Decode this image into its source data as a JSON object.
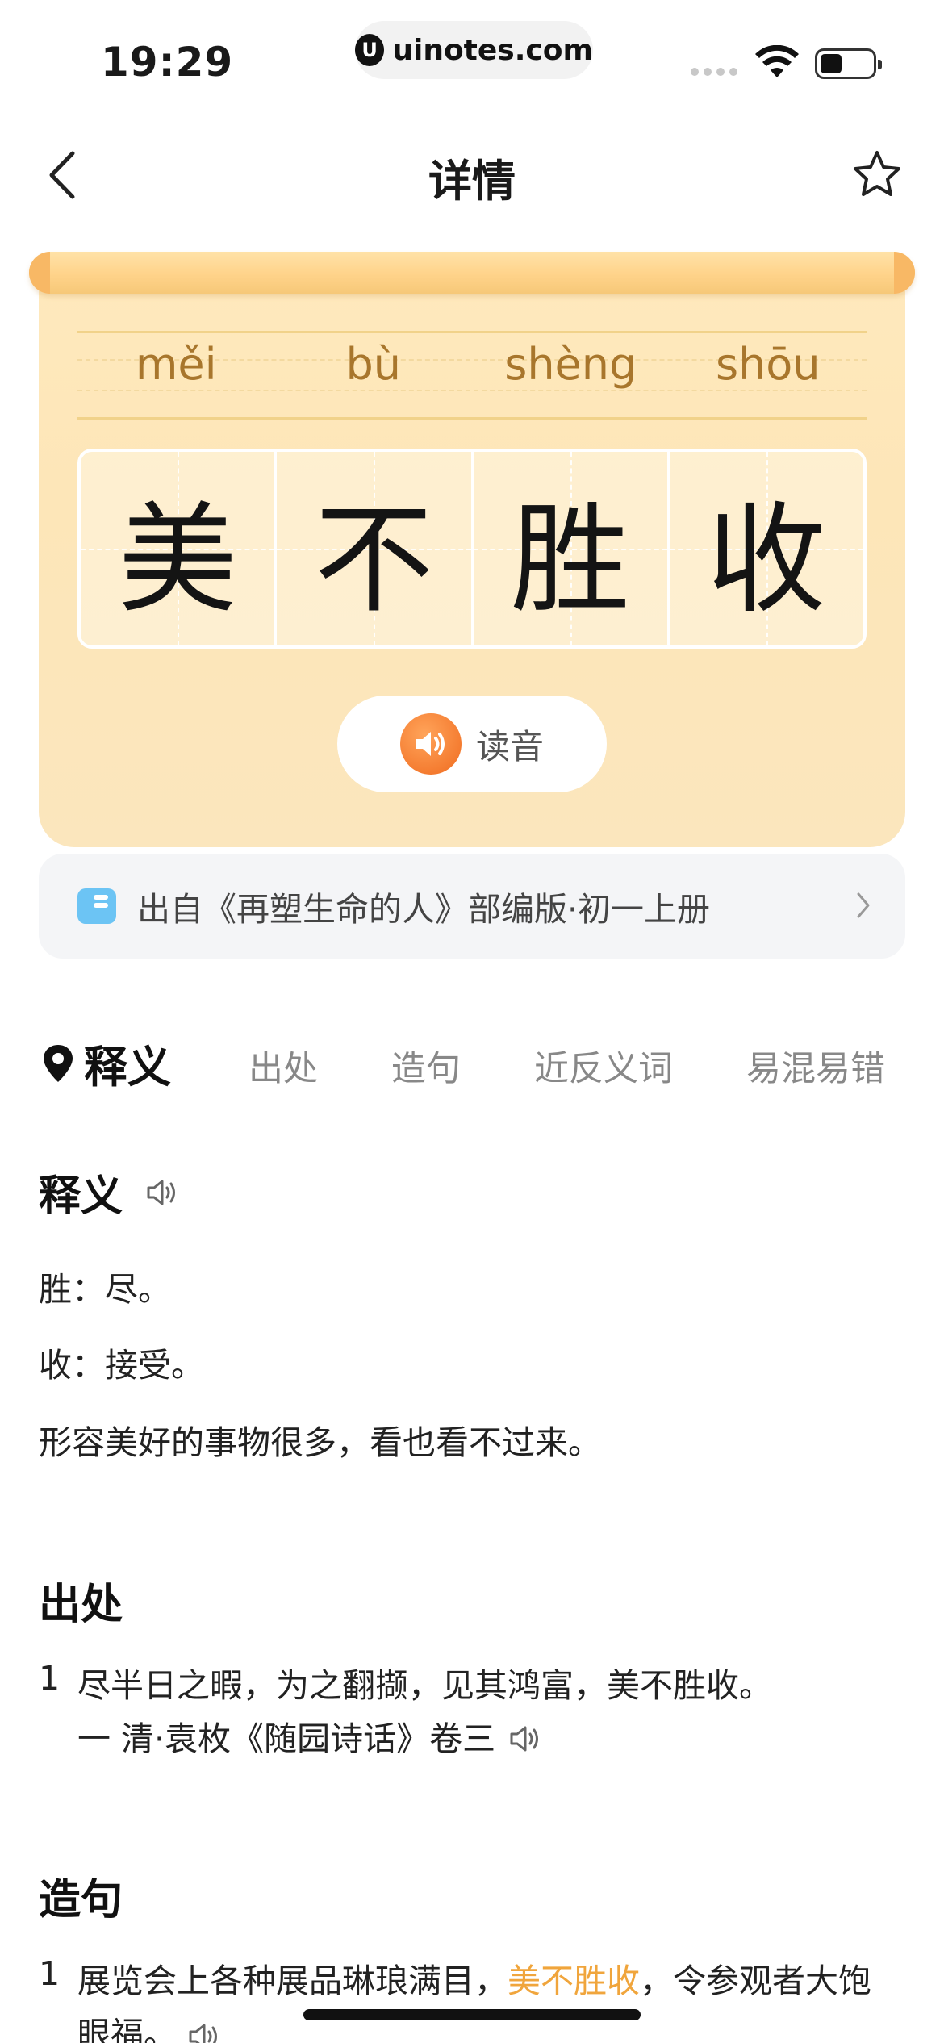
{
  "status_bar": {
    "time": "19:29",
    "url": "uinotes.com"
  },
  "nav": {
    "title": "详情"
  },
  "idiom": {
    "pinyin": [
      "měi",
      "bù",
      "shèng",
      "shōu"
    ],
    "chars": [
      "美",
      "不",
      "胜",
      "收"
    ],
    "read_label": "读音"
  },
  "source": {
    "text": "出自《再塑生命的人》部编版·初一上册"
  },
  "tabs": [
    {
      "label": "释义"
    },
    {
      "label": "出处"
    },
    {
      "label": "造句"
    },
    {
      "label": "近反义词"
    },
    {
      "label": "易混易错"
    }
  ],
  "meaning": {
    "title": "释义",
    "lines": [
      "胜：尽。",
      "收：接受。",
      "形容美好的事物很多，看也看不过来。"
    ]
  },
  "origin": {
    "title": "出处",
    "items": [
      {
        "num": "1",
        "text": "尽半日之暇，为之翻撷，见其鸿富，美不胜收。",
        "attribution": "一 清·袁枚《随园诗话》卷三"
      }
    ]
  },
  "examples": {
    "title": "造句",
    "items": [
      {
        "num": "1",
        "before": "展览会上各种展品琳琅满目，",
        "highlight": "美不胜收",
        "after": "，令参观者大饱眼福。"
      }
    ]
  },
  "colors": {
    "accent": "#f0a53c",
    "speaker": "#f06b1f",
    "scroll": "#fde6b8"
  }
}
